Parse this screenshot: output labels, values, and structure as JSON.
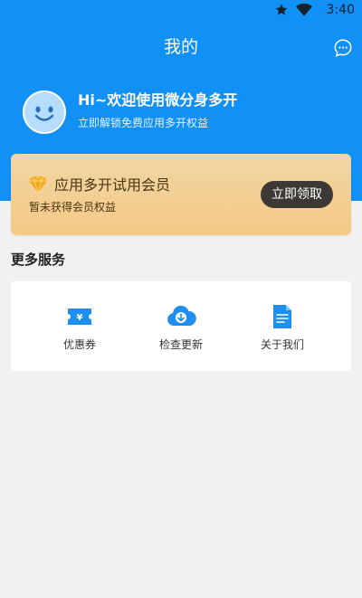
{
  "status_bar": {
    "time": "3:40",
    "icons": [
      "star-icon",
      "wifi-icon",
      "battery-icon"
    ]
  },
  "header": {
    "title": "我的",
    "right_icon": "message-icon"
  },
  "profile": {
    "avatar_icon": "smiley-avatar-icon",
    "greeting": "Hi~欢迎使用微分身多开",
    "subtitle": "立即解锁免费应用多开权益"
  },
  "vip_card": {
    "icon": "diamond-icon",
    "title": "应用多开试用会员",
    "subtitle": "暂未获得会员权益",
    "button_label": "立即领取"
  },
  "services": {
    "section_title": "更多服务",
    "items": [
      {
        "label": "优惠券",
        "icon": "coupon-icon"
      },
      {
        "label": "检查更新",
        "icon": "cloud-download-icon"
      },
      {
        "label": "关于我们",
        "icon": "document-icon"
      }
    ]
  },
  "colors": {
    "primary_blue": "#1190f6",
    "page_background": "#f1f1f1",
    "vip_gold_start": "#f0d6a6",
    "vip_gold_end": "#f5c984",
    "vip_button": "#3d3a36"
  }
}
